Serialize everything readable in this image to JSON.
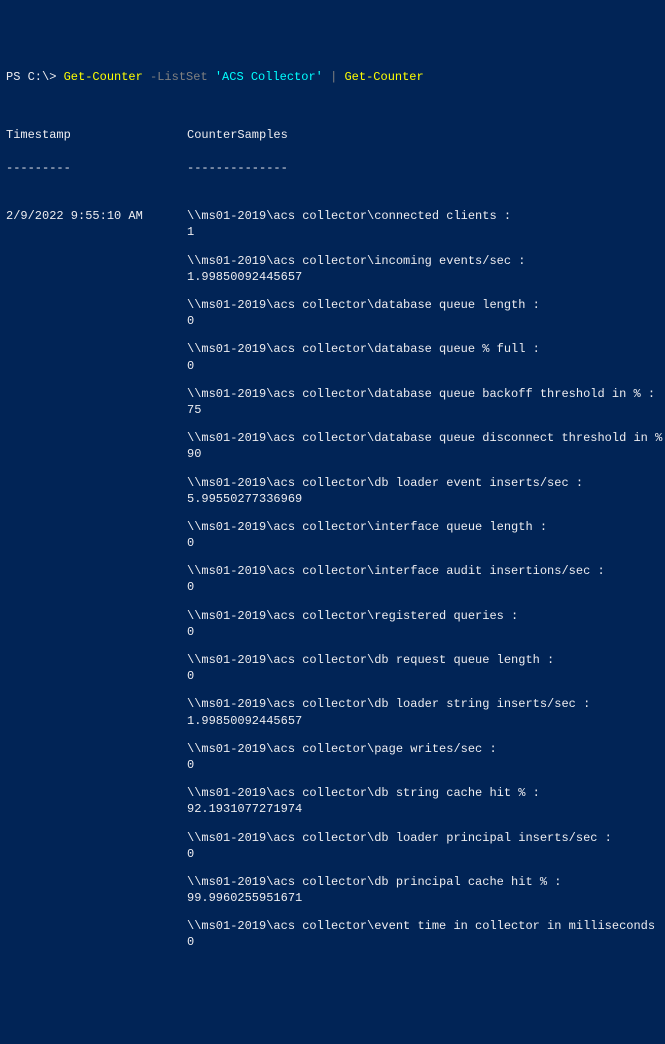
{
  "prompt": {
    "prefix": "PS C:\\> ",
    "cmd1": "Get-Counter",
    "param": " -ListSet ",
    "arg": "'ACS Collector'",
    "space": " ",
    "pipe": "|",
    "space2": " ",
    "cmd2": "Get-Counter"
  },
  "headers": {
    "timestamp": "Timestamp",
    "countersamples": "CounterSamples",
    "timestamp_dash": "---------",
    "countersamples_dash": "--------------"
  },
  "timestamp_value": "2/9/2022 9:55:10 AM",
  "samples": [
    {
      "path": "\\\\ms01-2019\\acs collector\\connected clients :",
      "value": "1"
    },
    {
      "path": "\\\\ms01-2019\\acs collector\\incoming events/sec :",
      "value": "1.99850092445657"
    },
    {
      "path": "\\\\ms01-2019\\acs collector\\database queue length :",
      "value": "0"
    },
    {
      "path": "\\\\ms01-2019\\acs collector\\database queue % full :",
      "value": "0"
    },
    {
      "path": "\\\\ms01-2019\\acs collector\\database queue backoff threshold in % :",
      "value": "75"
    },
    {
      "path": "\\\\ms01-2019\\acs collector\\database queue disconnect threshold in % :",
      "value": "90"
    },
    {
      "path": "\\\\ms01-2019\\acs collector\\db loader event inserts/sec :",
      "value": "5.99550277336969"
    },
    {
      "path": "\\\\ms01-2019\\acs collector\\interface queue length :",
      "value": "0"
    },
    {
      "path": "\\\\ms01-2019\\acs collector\\interface audit insertions/sec :",
      "value": "0"
    },
    {
      "path": "\\\\ms01-2019\\acs collector\\registered queries :",
      "value": "0"
    },
    {
      "path": "\\\\ms01-2019\\acs collector\\db request queue length :",
      "value": "0"
    },
    {
      "path": "\\\\ms01-2019\\acs collector\\db loader string inserts/sec :",
      "value": "1.99850092445657"
    },
    {
      "path": "\\\\ms01-2019\\acs collector\\page writes/sec :",
      "value": "0"
    },
    {
      "path": "\\\\ms01-2019\\acs collector\\db string cache hit % :",
      "value": "92.1931077271974"
    },
    {
      "path": "\\\\ms01-2019\\acs collector\\db loader principal inserts/sec :",
      "value": "0"
    },
    {
      "path": "\\\\ms01-2019\\acs collector\\db principal cache hit % :",
      "value": "99.9960255951671"
    },
    {
      "path": "\\\\ms01-2019\\acs collector\\event time in collector in milliseconds :",
      "value": "0"
    }
  ]
}
